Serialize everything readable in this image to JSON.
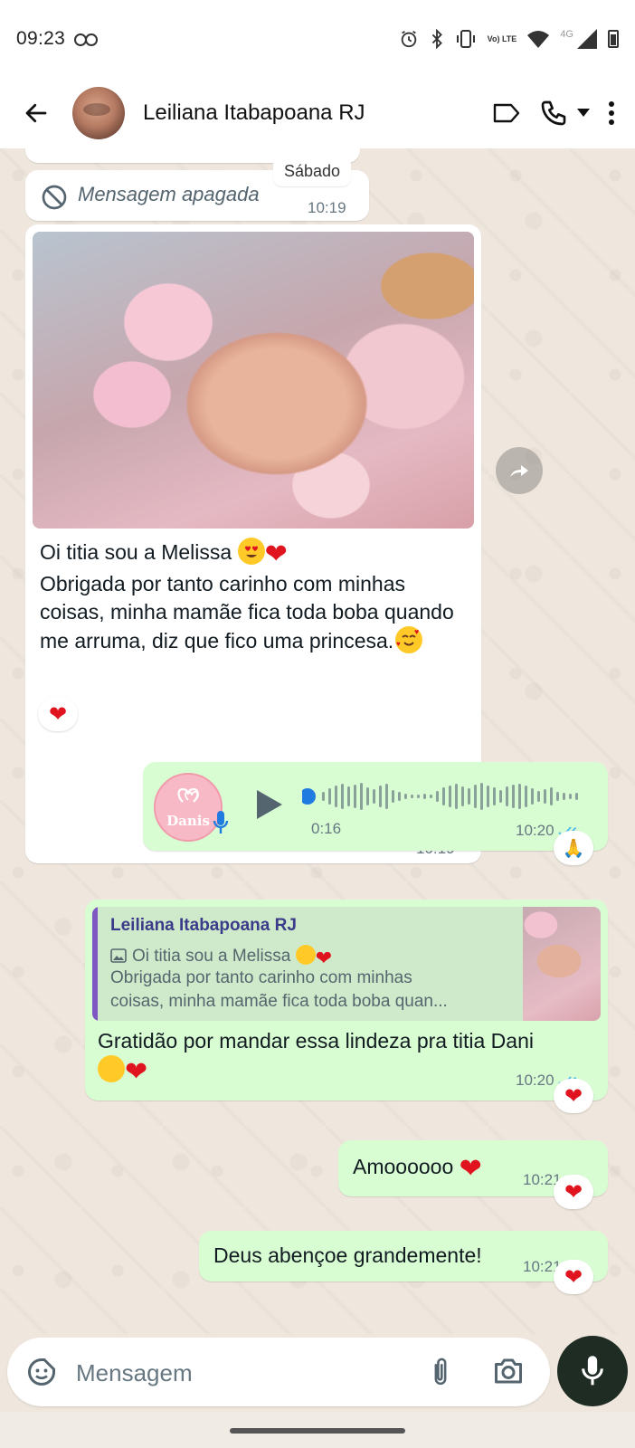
{
  "status_bar": {
    "time": "09:23",
    "lte": "Vo) LTE",
    "network": "4G"
  },
  "header": {
    "contact_name": "Leiliana Itabapoana RJ"
  },
  "chat": {
    "date_chip": "Sábado",
    "deleted_message": {
      "text": "Mensagem apagada",
      "time": "10:19"
    },
    "image_message": {
      "line1": "Oi titia sou a Melissa",
      "line2": "Obrigada por tanto carinho com minhas coisas, minha mamãe fica toda boba quando me arruma, diz que fico uma princesa.",
      "time": "10:19",
      "reaction": "❤"
    },
    "voice_message": {
      "avatar_text": "Danis",
      "duration": "0:16",
      "time": "10:20",
      "reaction": "🙏"
    },
    "reply_message": {
      "quoted_name": "Leiliana Itabapoana RJ",
      "quoted_line1": "Oi titia sou a Melissa",
      "quoted_line2": "Obrigada por tanto carinho com minhas",
      "quoted_line3": "coisas, minha mamãe fica toda boba quan...",
      "body": "Gratidão por mandar essa lindeza pra titia Dani",
      "time": "10:20",
      "reaction": "❤"
    },
    "msg_amo": {
      "text": "Amoooooo",
      "time": "10:21",
      "reaction": "❤"
    },
    "msg_deus": {
      "text": "Deus abençoe grandemente!",
      "time": "10:21",
      "reaction": "❤"
    }
  },
  "composer": {
    "placeholder": "Mensagem"
  },
  "colors": {
    "outgoing_bubble": "#d9fdd3",
    "incoming_bubble": "#ffffff",
    "read_ticks": "#53bdeb",
    "chat_bg": "#efe7dd"
  }
}
